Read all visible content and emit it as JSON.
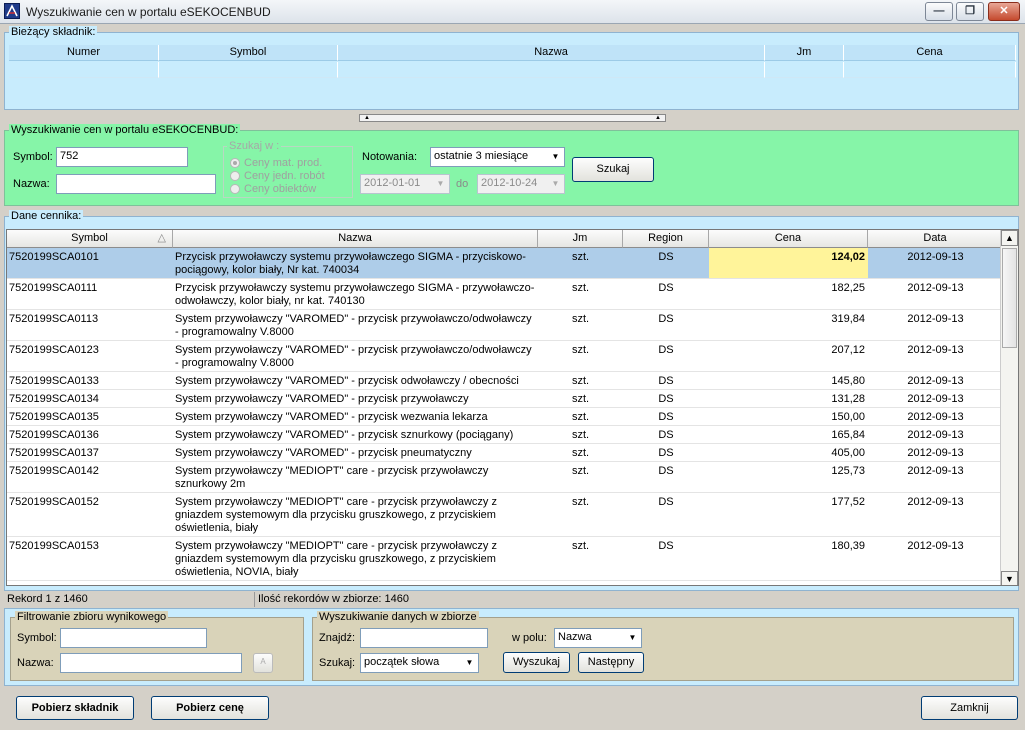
{
  "window": {
    "title": "Wyszukiwanie cen w portalu eSEKOCENBUD"
  },
  "current": {
    "legend": "Bieżący składnik:",
    "columns": [
      "Numer",
      "Symbol",
      "Nazwa",
      "Jm",
      "Cena"
    ]
  },
  "search": {
    "legend": "Wyszukiwanie cen  w portalu eSEKOCENBUD:",
    "symbol_label": "Symbol:",
    "symbol_value": "752",
    "nazwa_label": "Nazwa:",
    "nazwa_value": "",
    "szukaj_w_label": "Szukaj w :",
    "options": [
      "Ceny mat. prod.",
      "Ceny jedn. robót",
      "Ceny obiektów"
    ],
    "notowania_label": "Notowania:",
    "notowania_value": "ostatnie 3 miesiące",
    "date_from": "2012-01-01",
    "do_label": "do",
    "date_to": "2012-10-24",
    "szukaj_button": "Szukaj"
  },
  "table": {
    "legend": "Dane cennika:",
    "headers": [
      "Symbol",
      "Nazwa",
      "Jm",
      "Region",
      "Cena",
      "Data"
    ],
    "sort_indicator": "△",
    "rows": [
      {
        "symbol": "7520199SCA0101",
        "nazwa": "Przycisk przywoławczy systemu przywoławczego SIGMA - przyciskowo-pociągowy, kolor biały, Nr kat. 740034",
        "jm": "szt.",
        "region": "DS",
        "cena": "124,02",
        "data": "2012-09-13"
      },
      {
        "symbol": "7520199SCA0111",
        "nazwa": "Przycisk przywoławczy systemu przywoławczego SIGMA - przywoławczo-odwoławczy, kolor biały, nr kat. 740130",
        "jm": "szt.",
        "region": "DS",
        "cena": "182,25",
        "data": "2012-09-13"
      },
      {
        "symbol": "7520199SCA0113",
        "nazwa": "System przywoławczy  \"VAROMED\" - przycisk przywoławczo/odwoławczy - programowalny V.8000",
        "jm": "szt.",
        "region": "DS",
        "cena": "319,84",
        "data": "2012-09-13"
      },
      {
        "symbol": "7520199SCA0123",
        "nazwa": "System przywoławczy  \"VAROMED\" - przycisk przywoławczo/odwoławczy - programowalny V.8000",
        "jm": "szt.",
        "region": "DS",
        "cena": "207,12",
        "data": "2012-09-13"
      },
      {
        "symbol": "7520199SCA0133",
        "nazwa": "System przywoławczy  \"VAROMED\" - przycisk odwoławczy / obecności",
        "jm": "szt.",
        "region": "DS",
        "cena": "145,80",
        "data": "2012-09-13"
      },
      {
        "symbol": "7520199SCA0134",
        "nazwa": "System przywoławczy  \"VAROMED\" - przycisk przywoławczy",
        "jm": "szt.",
        "region": "DS",
        "cena": "131,28",
        "data": "2012-09-13"
      },
      {
        "symbol": "7520199SCA0135",
        "nazwa": "System przywoławczy  \"VAROMED\" - przycisk wezwania lekarza",
        "jm": "szt.",
        "region": "DS",
        "cena": "150,00",
        "data": "2012-09-13"
      },
      {
        "symbol": "7520199SCA0136",
        "nazwa": "System przywoławczy  \"VAROMED\" - przycisk sznurkowy (pociągany)",
        "jm": "szt.",
        "region": "DS",
        "cena": "165,84",
        "data": "2012-09-13"
      },
      {
        "symbol": "7520199SCA0137",
        "nazwa": "System przywoławczy  \"VAROMED\" - przycisk pneumatyczny",
        "jm": "szt.",
        "region": "DS",
        "cena": "405,00",
        "data": "2012-09-13"
      },
      {
        "symbol": "7520199SCA0142",
        "nazwa": "System przywoławczy \"MEDIOPT\" care - przycisk przywoławczy sznurkowy 2m",
        "jm": "szt.",
        "region": "DS",
        "cena": "125,73",
        "data": "2012-09-13"
      },
      {
        "symbol": "7520199SCA0152",
        "nazwa": "System przywoławczy \"MEDIOPT\" care - przycisk przywoławczy z gniazdem systemowym dla przycisku gruszkowego, z przyciskiem oświetlenia, biały",
        "jm": "szt.",
        "region": "DS",
        "cena": "177,52",
        "data": "2012-09-13"
      },
      {
        "symbol": "7520199SCA0153",
        "nazwa": "System przywoławczy \"MEDIOPT\" care - przycisk przywoławczy z gniazdem systemowym dla przycisku gruszkowego, z przyciskiem oświetlenia, NOVIA, biały",
        "jm": "szt.",
        "region": "DS",
        "cena": "180,39",
        "data": "2012-09-13"
      }
    ]
  },
  "status": {
    "record": "Rekord 1 z 1460",
    "count": "Ilość rekordów w zbiorze: 1460"
  },
  "filter": {
    "legend": "Filtrowanie zbioru wynikowego",
    "symbol_label": "Symbol:",
    "nazwa_label": "Nazwa:"
  },
  "find": {
    "legend": "Wyszukiwanie danych w zbiorze",
    "znajdz_label": "Znajdź:",
    "w_polu_label": "w polu:",
    "w_polu_value": "Nazwa",
    "szukaj_label": "Szukaj:",
    "szukaj_value": "początek słowa",
    "wyszukaj_button": "Wyszukaj",
    "nastepny_button": "Następny"
  },
  "footer": {
    "pobierz_skladnik": "Pobierz składnik",
    "pobierz_cene": "Pobierz cenę",
    "zamknij": "Zamknij"
  },
  "colors": {
    "green_panel": "#86f5a8",
    "blue_panel": "#c8ecfd",
    "tan_panel": "#d9d3b9",
    "selected_row": "#aecde9",
    "selected_cell": "#fff49a"
  }
}
